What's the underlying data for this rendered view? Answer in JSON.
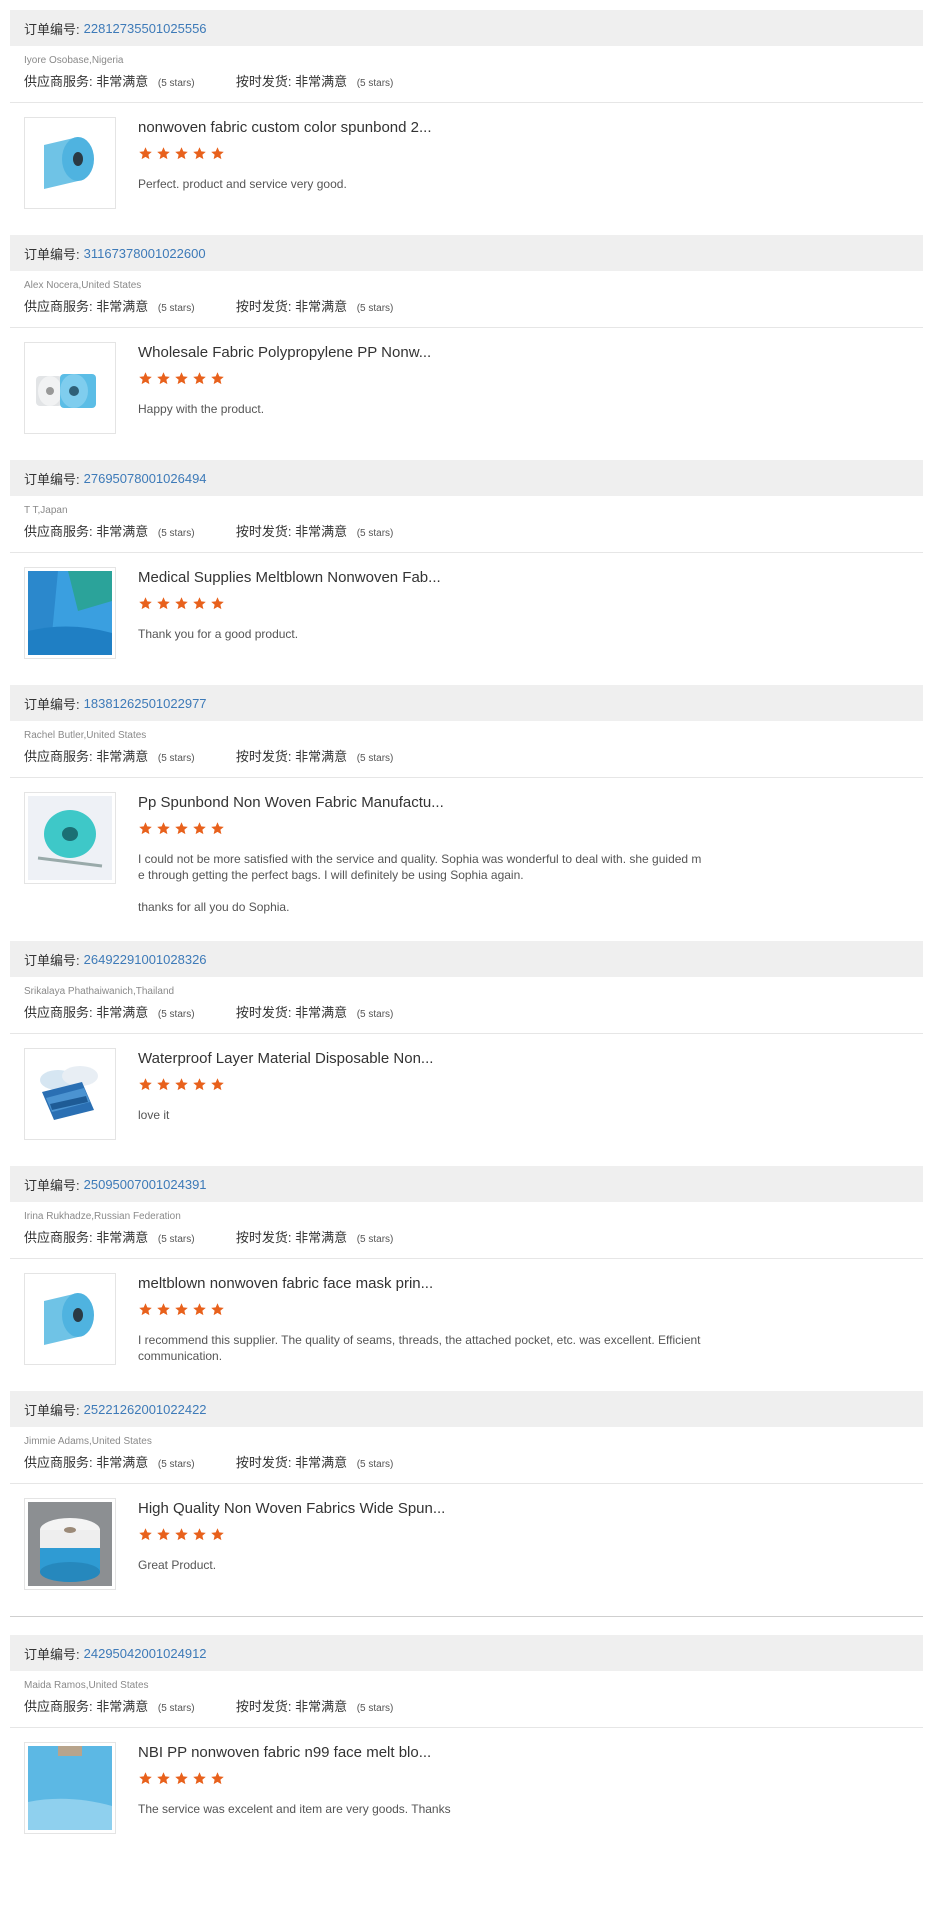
{
  "labels": {
    "order_prefix": "订单编号:",
    "supplier_service": "供应商服务:",
    "ontime_delivery": "按时发货:",
    "very_satisfied": "非常满意",
    "five_stars": "(5 stars)"
  },
  "colors": {
    "star": "#e8611c",
    "link": "#3d7ab8",
    "header_bg": "#efefef"
  },
  "reviews": [
    {
      "order": "22812735501025556",
      "buyer": "Iyore Osobase,Nigeria",
      "title": "nonwoven fabric custom color spunbond 2...",
      "rating": 5,
      "comment": "Perfect. product and service very good.",
      "thumb": "roll-icon"
    },
    {
      "order": "31167378001022600",
      "buyer": "Alex Nocera,United States",
      "title": "Wholesale Fabric Polypropylene PP Nonw...",
      "rating": 5,
      "comment": "Happy with the product.",
      "thumb": "two-rolls-icon"
    },
    {
      "order": "27695078001026494",
      "buyer": "T T,Japan",
      "title": "Medical Supplies Meltblown Nonwoven Fab...",
      "rating": 5,
      "comment": "Thank you for a good product.",
      "thumb": "fabric-sheets-icon"
    },
    {
      "order": "18381262501022977",
      "buyer": "Rachel Butler,United States",
      "title": "Pp Spunbond Non Woven Fabric Manufactu...",
      "rating": 5,
      "comment": "I could not be more satisfied with the service and quality. Sophia was wonderful to deal with. she guided m\ne through getting the perfect bags.  I will definitely be using Sophia again.\n\nthanks for all you do Sophia.",
      "thumb": "teal-roll-icon"
    },
    {
      "order": "26492291001028326",
      "buyer": "Srikalaya Phathaiwanich,Thailand",
      "title": "Waterproof Layer Material Disposable Non...",
      "rating": 5,
      "comment": "love it",
      "thumb": "stacked-sheets-icon"
    },
    {
      "order": "25095007001024391",
      "buyer": "Irina Rukhadze,Russian Federation",
      "title": "meltblown nonwoven fabric face mask prin...",
      "rating": 5,
      "comment": "I recommend this supplier. The quality of seams, threads, the attached pocket, etc. was excellent. Efficient\ncommunication.",
      "thumb": "roll-icon"
    },
    {
      "order": "25221262001022422",
      "buyer": "Jimmie Adams,United States",
      "title": "High Quality Non Woven Fabrics Wide Spun...",
      "rating": 5,
      "comment": "Great Product.",
      "thumb": "white-blue-roll-icon"
    },
    {
      "order": "24295042001024912",
      "buyer": "Maida Ramos,United States",
      "title": "NBI PP nonwoven fabric n99 face melt blo...",
      "rating": 5,
      "comment": "The service was excelent and item are very goods. Thanks",
      "thumb": "fabric-closeup-icon"
    }
  ]
}
